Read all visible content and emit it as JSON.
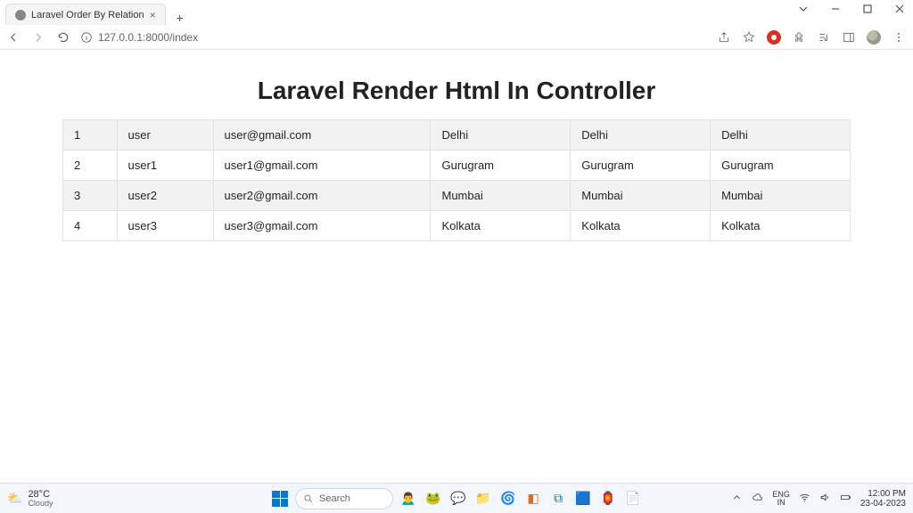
{
  "window": {
    "tab_title": "Laravel Order By Relation",
    "url": "127.0.0.1:8000/index"
  },
  "page": {
    "heading": "Laravel Render Html In Controller"
  },
  "table": {
    "rows": [
      {
        "id": "1",
        "name": "user",
        "email": "user@gmail.com",
        "c1": "Delhi",
        "c2": "Delhi",
        "c3": "Delhi"
      },
      {
        "id": "2",
        "name": "user1",
        "email": "user1@gmail.com",
        "c1": "Gurugram",
        "c2": "Gurugram",
        "c3": "Gurugram"
      },
      {
        "id": "3",
        "name": "user2",
        "email": "user2@gmail.com",
        "c1": "Mumbai",
        "c2": "Mumbai",
        "c3": "Mumbai"
      },
      {
        "id": "4",
        "name": "user3",
        "email": "user3@gmail.com",
        "c1": "Kolkata",
        "c2": "Kolkata",
        "c3": "Kolkata"
      }
    ]
  },
  "taskbar": {
    "weather_temp": "28°C",
    "weather_cond": "Cloudy",
    "search_label": "Search",
    "lang1": "ENG",
    "lang2": "IN",
    "time": "12:00 PM",
    "date": "23-04-2023"
  }
}
